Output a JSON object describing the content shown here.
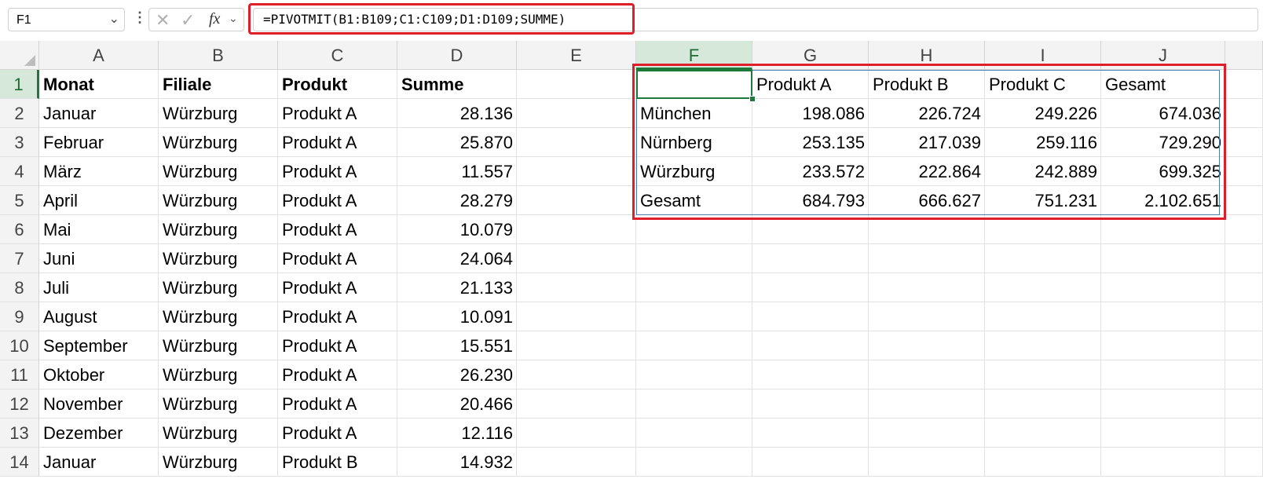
{
  "formula_bar": {
    "name_box": "F1",
    "formula": "=PIVOTMIT(B1:B109;C1:C109;D1:D109;SUMME)",
    "icons": [
      "chevron-down-icon",
      "more-icon",
      "cancel-icon",
      "enter-icon",
      "fx-icon"
    ]
  },
  "columns": [
    "A",
    "B",
    "C",
    "D",
    "E",
    "F",
    "G",
    "H",
    "I",
    "J"
  ],
  "rows": [
    "1",
    "2",
    "3",
    "4",
    "5",
    "6",
    "7",
    "8",
    "9",
    "10",
    "11",
    "12",
    "13",
    "14"
  ],
  "data_table": {
    "headers": [
      "Monat",
      "Filiale",
      "Produkt",
      "Summe"
    ],
    "rows": [
      [
        "Januar",
        "Würzburg",
        "Produkt A",
        "28.136"
      ],
      [
        "Februar",
        "Würzburg",
        "Produkt A",
        "25.870"
      ],
      [
        "März",
        "Würzburg",
        "Produkt A",
        "11.557"
      ],
      [
        "April",
        "Würzburg",
        "Produkt A",
        "28.279"
      ],
      [
        "Mai",
        "Würzburg",
        "Produkt A",
        "10.079"
      ],
      [
        "Juni",
        "Würzburg",
        "Produkt A",
        "24.064"
      ],
      [
        "Juli",
        "Würzburg",
        "Produkt A",
        "21.133"
      ],
      [
        "August",
        "Würzburg",
        "Produkt A",
        "10.091"
      ],
      [
        "September",
        "Würzburg",
        "Produkt A",
        "15.551"
      ],
      [
        "Oktober",
        "Würzburg",
        "Produkt A",
        "26.230"
      ],
      [
        "November",
        "Würzburg",
        "Produkt A",
        "20.466"
      ],
      [
        "Dezember",
        "Würzburg",
        "Produkt A",
        "12.116"
      ],
      [
        "Januar",
        "Würzburg",
        "Produkt B",
        "14.932"
      ]
    ]
  },
  "pivot": {
    "headers": [
      "",
      "Produkt A",
      "Produkt B",
      "Produkt C",
      "Gesamt"
    ],
    "rows": [
      [
        "München",
        "198.086",
        "226.724",
        "249.226",
        "674.036"
      ],
      [
        "Nürnberg",
        "253.135",
        "217.039",
        "259.116",
        "729.290"
      ],
      [
        "Würzburg",
        "233.572",
        "222.864",
        "242.889",
        "699.325"
      ],
      [
        "Gesamt",
        "684.793",
        "666.627",
        "751.231",
        "2.102.651"
      ]
    ]
  },
  "colors": {
    "highlight": "#e01e2b",
    "selection": "#1e7a3a",
    "header_bg": "#f3f3f3"
  }
}
